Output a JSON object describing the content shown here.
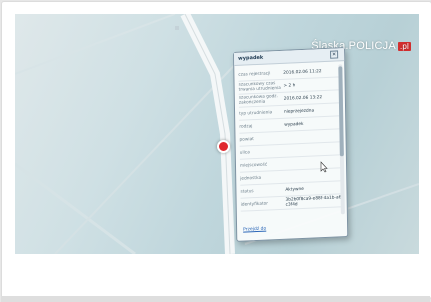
{
  "brand": {
    "name": "Śląska.POLICJA",
    "suffix": ".pl",
    "accent": "#d32f2f"
  },
  "popup": {
    "title": "wypadek",
    "close_glyph": "×",
    "rows": [
      {
        "key": "czas rejestracji",
        "value": "2016.02.06 11:22"
      },
      {
        "key": "szacunkowy czas trwania utrudnienia",
        "value": "> 2 h"
      },
      {
        "key": "szacunkowa godz. zakończenia",
        "value": "2016.02.06 13:22"
      },
      {
        "key": "typ utrudnienia",
        "value": "nieprzejezdna"
      },
      {
        "key": "rodzaj",
        "value": "wypadek"
      },
      {
        "key": "powiat",
        "value": ""
      },
      {
        "key": "ulica",
        "value": ""
      },
      {
        "key": "miejscowość",
        "value": ""
      },
      {
        "key": "jednostka",
        "value": ""
      },
      {
        "key": "status",
        "value": "Aktywne"
      },
      {
        "key": "identyfikator",
        "value": "3b2b0f8ca9-e88f-4a1b-a6c3f4d"
      }
    ],
    "link": "Przejdź do"
  },
  "marker": {
    "color": "#e0292f"
  }
}
